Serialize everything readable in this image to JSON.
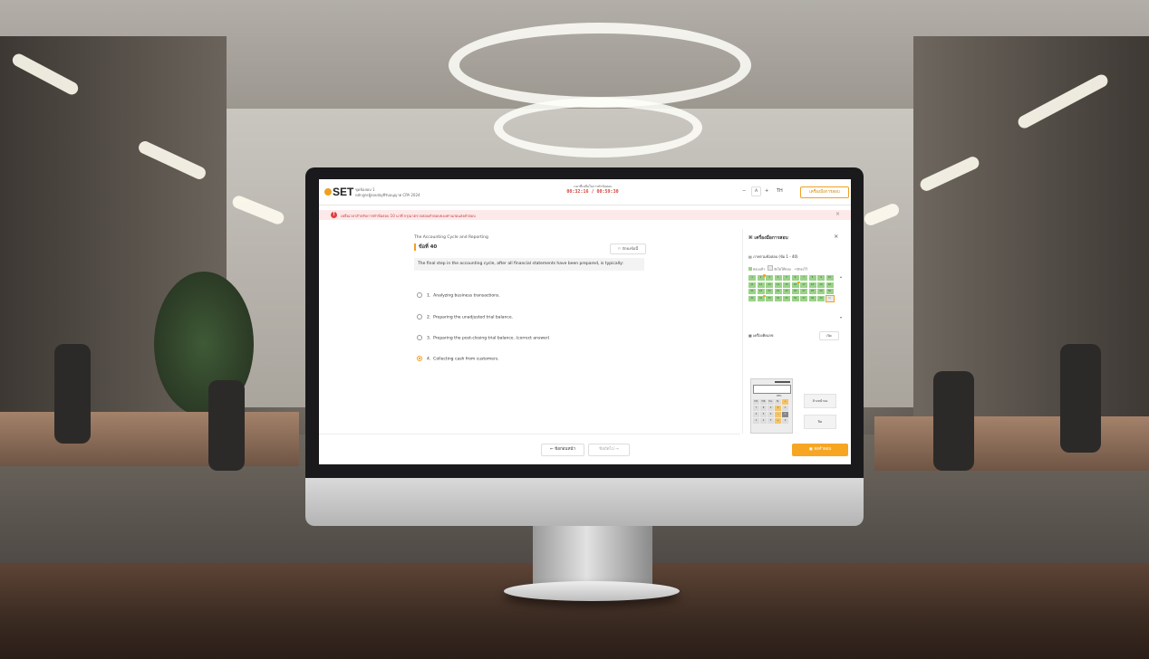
{
  "header": {
    "logo_text": "SET",
    "session_line1": "ชุดข้อสอบ 1",
    "session_line2": "หลักสูตรผู้สอบบัญชีรับอนุญาต CPA 2024",
    "timer_label": "เวลาที่เหลือในการทำข้อสอบ",
    "timer_value": "00:32:16 / 00:59:30",
    "zoom_out": "−",
    "zoom_level": "A",
    "zoom_in": "+",
    "lang": "TH",
    "menu_button": "เครื่องมือการสอบ"
  },
  "alert": {
    "icon": "!",
    "text": "เหลือเวลาสำหรับการทำข้อสอบ 10 นาที กรุณาตรวจสอบคำตอบของท่านก่อนส่งคำตอบ",
    "close": "×"
  },
  "question": {
    "chapter": "The Accounting Cycle and Reporting",
    "number": "ข้อที่ 40",
    "flag_label": "ปักธงข้อนี้",
    "text": "The final step in the accounting cycle, after all financial statements have been prepared, is typically:",
    "options": [
      {
        "num": "1.",
        "text": "Analyzing business transactions.",
        "selected": false
      },
      {
        "num": "2.",
        "text": "Preparing the unadjusted trial balance.",
        "selected": false
      },
      {
        "num": "3.",
        "text": "Preparing the post-closing trial balance. (correct answer)",
        "selected": false
      },
      {
        "num": "4.",
        "text": "Collecting cash from customers.",
        "selected": true
      }
    ]
  },
  "nav": {
    "prev": "← ข้อก่อนหน้า",
    "next": "ข้อถัดไป →",
    "submit": "ส่งคำตอบ"
  },
  "panel": {
    "title": "เครื่องมือการสอบ",
    "close": "×",
    "overview_title": "ภาพรวมข้อสอบ (ข้อ 1 - 40)",
    "legend": [
      "ตอบแล้ว",
      "ยังไม่ได้ตอบ",
      "ปักธงไว้"
    ],
    "questions": [
      {
        "n": "1",
        "s": "answered"
      },
      {
        "n": "2",
        "s": "flagged"
      },
      {
        "n": "3",
        "s": "answered"
      },
      {
        "n": "4",
        "s": "answered"
      },
      {
        "n": "5",
        "s": "answered"
      },
      {
        "n": "6",
        "s": "answered"
      },
      {
        "n": "7",
        "s": "answered"
      },
      {
        "n": "8",
        "s": "answered"
      },
      {
        "n": "9",
        "s": "answered"
      },
      {
        "n": "10",
        "s": "answered"
      },
      {
        "n": "11",
        "s": "answered"
      },
      {
        "n": "12",
        "s": "answered"
      },
      {
        "n": "13",
        "s": "answered"
      },
      {
        "n": "14",
        "s": "answered"
      },
      {
        "n": "15",
        "s": "answered"
      },
      {
        "n": "16",
        "s": "flagged"
      },
      {
        "n": "17",
        "s": "answered"
      },
      {
        "n": "18",
        "s": "answered"
      },
      {
        "n": "19",
        "s": "answered"
      },
      {
        "n": "20",
        "s": "answered"
      },
      {
        "n": "21",
        "s": "answered"
      },
      {
        "n": "22",
        "s": "answered"
      },
      {
        "n": "23",
        "s": "answered"
      },
      {
        "n": "24",
        "s": "answered"
      },
      {
        "n": "25",
        "s": "answered"
      },
      {
        "n": "26",
        "s": "answered"
      },
      {
        "n": "27",
        "s": "answered"
      },
      {
        "n": "28",
        "s": "answered"
      },
      {
        "n": "29",
        "s": "answered"
      },
      {
        "n": "30",
        "s": "answered"
      },
      {
        "n": "31",
        "s": "answered"
      },
      {
        "n": "32",
        "s": "flagged"
      },
      {
        "n": "33",
        "s": "answered"
      },
      {
        "n": "34",
        "s": "answered"
      },
      {
        "n": "35",
        "s": "answered"
      },
      {
        "n": "36",
        "s": "answered"
      },
      {
        "n": "37",
        "s": "answered"
      },
      {
        "n": "38",
        "s": "answered"
      },
      {
        "n": "39",
        "s": "answered"
      },
      {
        "n": "40",
        "s": "current"
      }
    ],
    "calculator_title": "เครื่องคิดเลข",
    "calculator_open": "เปิด",
    "calc_mode": "DEG",
    "calc_keys": [
      "MC",
      "MR",
      "M+",
      "M-",
      "÷",
      "7",
      "8",
      "9",
      "×",
      "C",
      "4",
      "5",
      "6",
      "−",
      "=",
      "1",
      "2",
      "3",
      "+",
      "0"
    ],
    "side_btn_1": "ล้างหน้าจอ",
    "side_btn_2": "ปิด"
  },
  "colors": {
    "accent": "#f0a020",
    "answered": "#9bd28a",
    "alert_bg": "#fde9e9",
    "alert_text": "#c23b3b",
    "timer": "#d0453c"
  }
}
